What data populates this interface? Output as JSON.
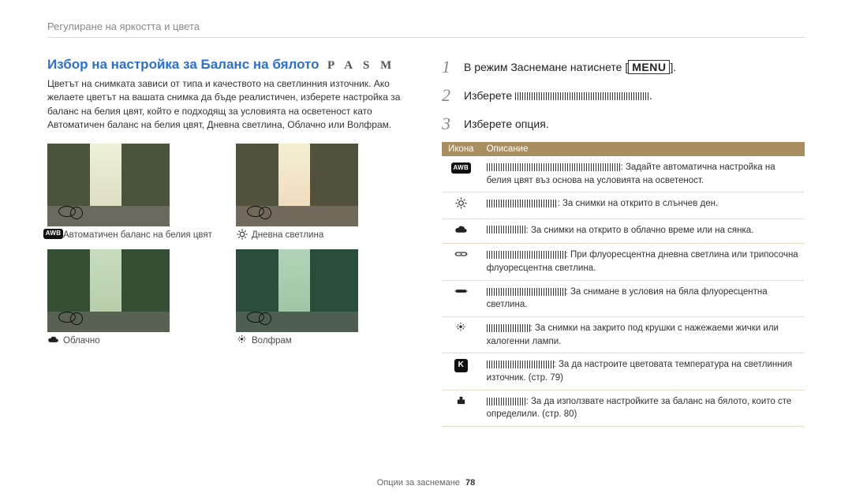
{
  "breadcrumb": "Регулиране на яркостта и цвета",
  "left": {
    "title": "Избор на настройка за Баланс на бялото",
    "modes": "P A S M",
    "intro": "Цветът на снимката зависи от типа и качеството на светлинния източник. Ако желаете цветът на вашата снимка да бъде реалистичен, изберете настройка за баланс на белия цвят, който е подходящ за условията на осветеност като Автоматичен баланс на белия цвят, Дневна светлина, Облачно или Волфрам.",
    "thumbs": [
      {
        "caption": "Автоматичен баланс на белия цвят",
        "icon": "awb"
      },
      {
        "caption": "Дневна светлина",
        "icon": "sun"
      },
      {
        "caption": "Облачно",
        "icon": "cloud"
      },
      {
        "caption": "Волфрам",
        "icon": "bulb"
      }
    ]
  },
  "right": {
    "steps": [
      {
        "num": "1",
        "prefix": "В режим Заснемане натиснете [",
        "menu": "MENU",
        "suffix": "]."
      },
      {
        "num": "2",
        "prefix": "Изберете ",
        "obscured": true,
        "suffix": "."
      },
      {
        "num": "3",
        "prefix": "Изберете опция.",
        "obscured": false,
        "suffix": ""
      }
    ],
    "table": {
      "head_icon": "Икона",
      "head_desc": "Описание",
      "rows": [
        {
          "icon": "awb",
          "desc": ": Задайте автоматична настройка на белия цвят въз основа на условията на осветеност."
        },
        {
          "icon": "sun",
          "desc": ": За снимки на открито в слънчев ден."
        },
        {
          "icon": "cloud",
          "desc": ": За снимки на открито в облачно време или на сянка."
        },
        {
          "icon": "fluor-d",
          "desc": ": При флуоресцентна дневна светлина или трипосочна флуоресцентна светлина."
        },
        {
          "icon": "fluor-w",
          "desc": ": За снимане в условия на бяла флуоресцентна светлина."
        },
        {
          "icon": "bulb",
          "desc": ": За снимки на закрито под крушки с нажежаеми жички или халогенни лампи."
        },
        {
          "icon": "kelvin",
          "desc": ": За да настроите цветовата температура на светлинния източник. (стр. 79)"
        },
        {
          "icon": "custom",
          "desc": ": За да използвате настройките за баланс на бялото, които сте определили. (стр. 80)"
        }
      ]
    }
  },
  "footer": {
    "text": "Опции за заснемане",
    "page": "78"
  }
}
